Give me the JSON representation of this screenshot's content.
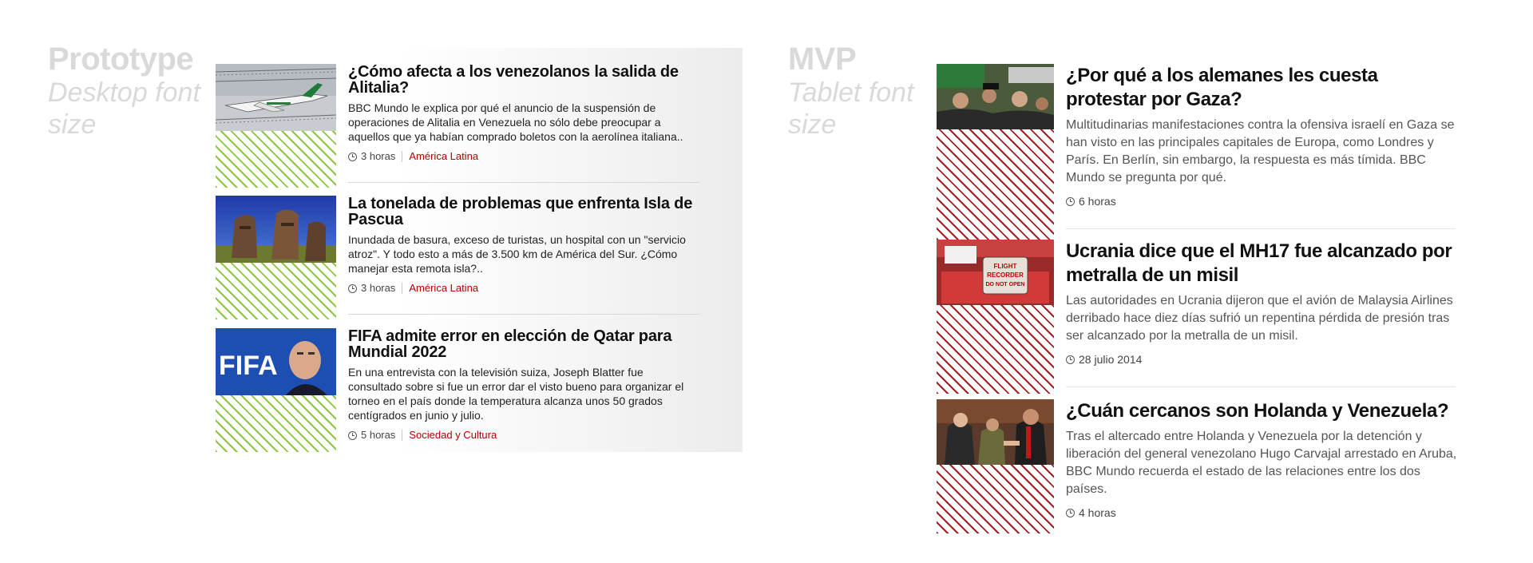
{
  "prototype_label": {
    "title": "Prototype",
    "subtitle": "Desktop font size"
  },
  "mvp_label": {
    "title": "MVP",
    "subtitle": "Tablet font size"
  },
  "prototype_items": [
    {
      "headline": "¿Cómo afecta a los venezolanos la salida de Alitalia?",
      "summary": "BBC Mundo le explica por qué el anuncio de la suspensión de operaciones de Alitalia en Venezuela no sólo debe preocupar a aquellos que ya habían comprado boletos con la aerolínea italiana..",
      "time": "3 horas",
      "category": "América Latina",
      "image": "airplane-photo"
    },
    {
      "headline": "La tonelada de problemas que enfrenta Isla de Pascua",
      "summary": "Inundada de basura, exceso de turistas, un hospital con un \"servicio atroz\". Y todo esto a más de 3.500 km de América del Sur. ¿Cómo manejar esta remota isla?..",
      "time": "3 horas",
      "category": "América Latina",
      "image": "moai-photo"
    },
    {
      "headline": "FIFA admite error en elección de Qatar para Mundial 2022",
      "summary": "En una entrevista con la televisión suiza, Joseph Blatter fue consultado sobre si fue un error dar el visto bueno para organizar el torneo en el país donde la temperatura alcanza unos 50 grados centígrados en junio y julio.",
      "time": "5 horas",
      "category": "Sociedad y Cultura",
      "image": "fifa-photo"
    }
  ],
  "mvp_items": [
    {
      "headline": "¿Por qué a los alemanes les cuesta protestar por Gaza?",
      "summary": "Multitudinarias manifestaciones contra la ofensiva israelí en Gaza se han visto en las principales capitales de Europa, como Londres y París. En Berlín, sin embargo, la respuesta es más tímida. BBC Mundo se pregunta por qué.",
      "time": "6 horas",
      "image": "protest-photo"
    },
    {
      "headline": "Ucrania dice que el MH17 fue alcanzado por metralla de un misil",
      "summary": "Las autoridades en Ucrania dijeron que el avión de Malaysia Airlines derribado hace diez días sufrió un repentina pérdida de presión tras ser alcanzado por la metralla de un misil.",
      "time": "28 julio 2014",
      "image": "flight-recorder-photo"
    },
    {
      "headline": "¿Cuán cercanos son Holanda y Venezuela?",
      "summary": "Tras el altercado entre Holanda y Venezuela por la detención y liberación del general venezolano Hugo Carvajal arrestado en Aruba, BBC Mundo recuerda el estado de las relaciones entre los dos países.",
      "time": "4 horas",
      "image": "handshake-photo"
    }
  ],
  "image_text": {
    "fifa_logo": "FIFA",
    "recorder_label_1": "FLIGHT",
    "recorder_label_2": "RECORDER",
    "recorder_label_3": "DO NOT OPEN"
  },
  "colors": {
    "prototype_hatch": "#8cc63f",
    "mvp_hatch": "#a31e22",
    "category_link": "#b00000",
    "label_gray": "#d9d9d9"
  }
}
